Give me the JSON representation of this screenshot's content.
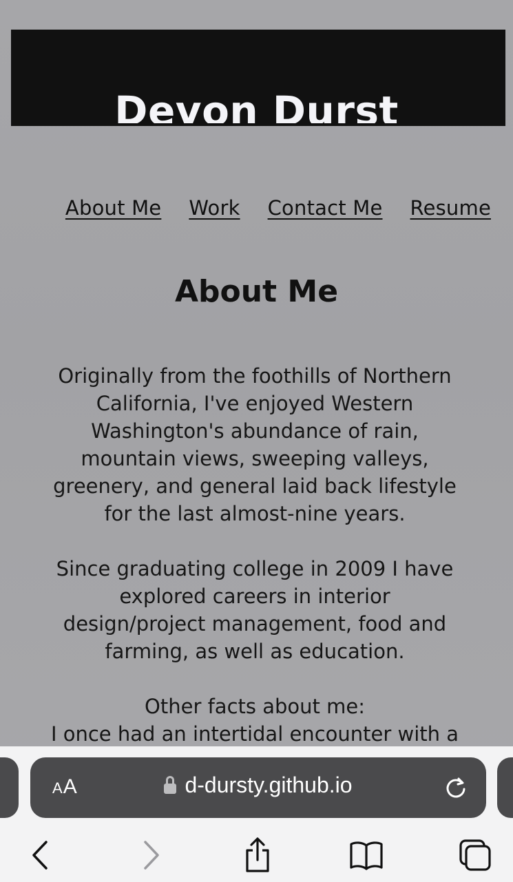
{
  "header": {
    "title": "Devon Durst"
  },
  "nav": {
    "items": [
      {
        "label": "About Me"
      },
      {
        "label": "Work"
      },
      {
        "label": "Contact Me"
      },
      {
        "label": "Resume"
      }
    ]
  },
  "main": {
    "section_title": "About Me",
    "paragraphs": [
      "Originally from the foothills of Northern California, I've enjoyed Western Washington's abundance of rain, mountain views, sweeping valleys, greenery, and general laid back lifestyle for the last almost-nine years.",
      "Since graduating college in 2009 I have explored careers in interior design/project management, food and farming, as well as education.",
      "Other facts about me:",
      "I once had an intertidal encounter with a"
    ]
  },
  "browser": {
    "text_size_label_small": "A",
    "text_size_label_large": "A",
    "url": "d-dursty.github.io",
    "icons": {
      "lock": "lock-icon",
      "reload": "reload-icon",
      "back": "back-icon",
      "forward": "forward-icon",
      "share": "share-icon",
      "bookmarks": "bookmarks-icon",
      "tabs": "tabs-icon"
    },
    "colors": {
      "address_bar": "#4a4a4c",
      "toolbar_bg": "#f3f3f4",
      "icon_active": "#111111",
      "icon_disabled": "#9a9a9e"
    }
  },
  "colors": {
    "page_background": "#a3a3a6",
    "header_bar": "#111111",
    "title_text": "#f4f4f8"
  }
}
